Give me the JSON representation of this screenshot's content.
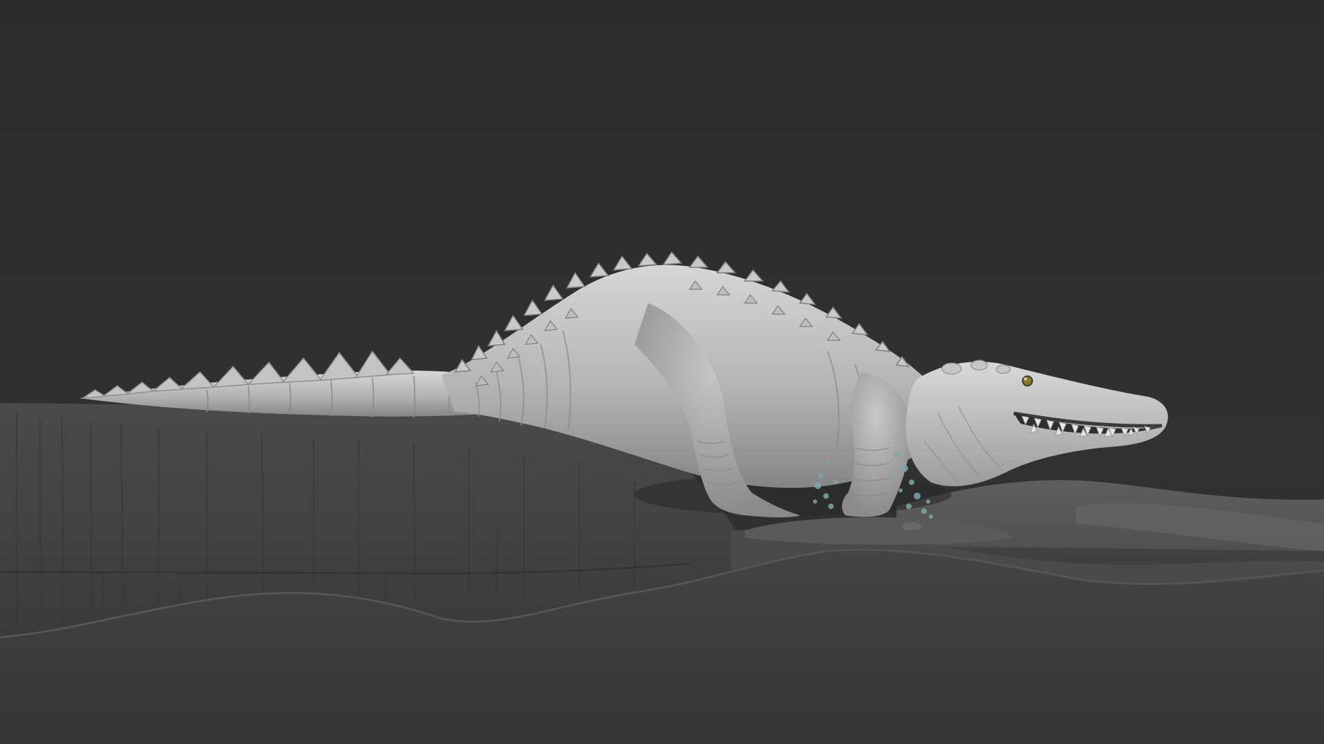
{
  "scene": {
    "subject": "crocodile-sculpt",
    "colors": {
      "background": "#2f2f2f",
      "ground_back": "#3b3b3b",
      "ground_mid": "#434343",
      "ground_front": "#3d3d3d",
      "clay_light": "#cfcfcf",
      "clay_mid": "#a9a9a9",
      "clay_shadow": "#7c7c7c",
      "splash": "#7fa6a8",
      "eye": "#8a7a2a"
    }
  }
}
